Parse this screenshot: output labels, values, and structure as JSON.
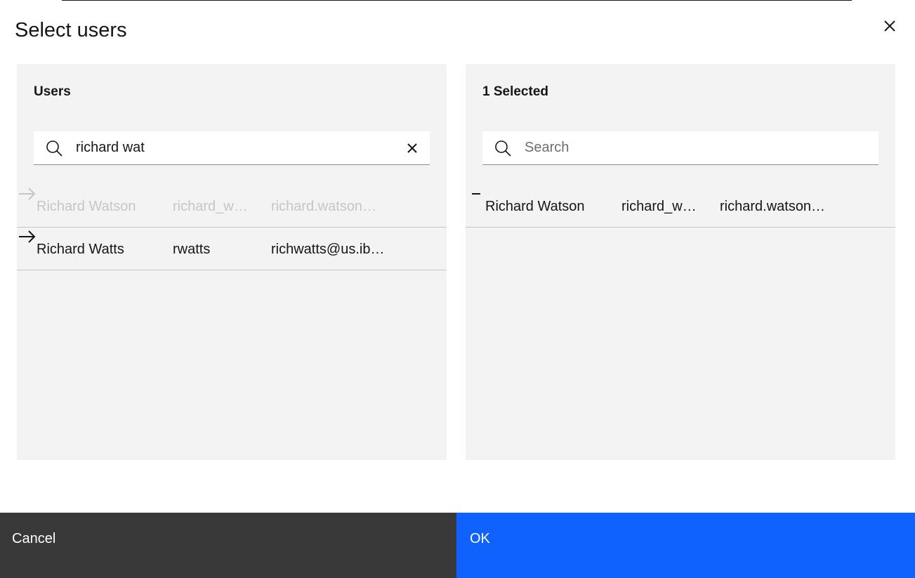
{
  "dialog": {
    "title": "Select users"
  },
  "available": {
    "heading": "Users",
    "search_value": "richard wat",
    "rows": [
      {
        "name": "Richard Watson",
        "username": "richard_w…",
        "email": "richard.watson…",
        "disabled": true
      },
      {
        "name": "Richard Watts",
        "username": "rwatts",
        "email": "richwatts@us.ib…",
        "disabled": false
      }
    ]
  },
  "selected": {
    "heading": "1 Selected",
    "search_placeholder": "Search",
    "rows": [
      {
        "name": "Richard Watson",
        "username": "richard_w…",
        "email": "richard.watson…"
      }
    ]
  },
  "footer": {
    "cancel_label": "Cancel",
    "ok_label": "OK"
  },
  "colors": {
    "primary": "#0f62fe",
    "secondary": "#393939",
    "panel": "#f3f3f3"
  }
}
